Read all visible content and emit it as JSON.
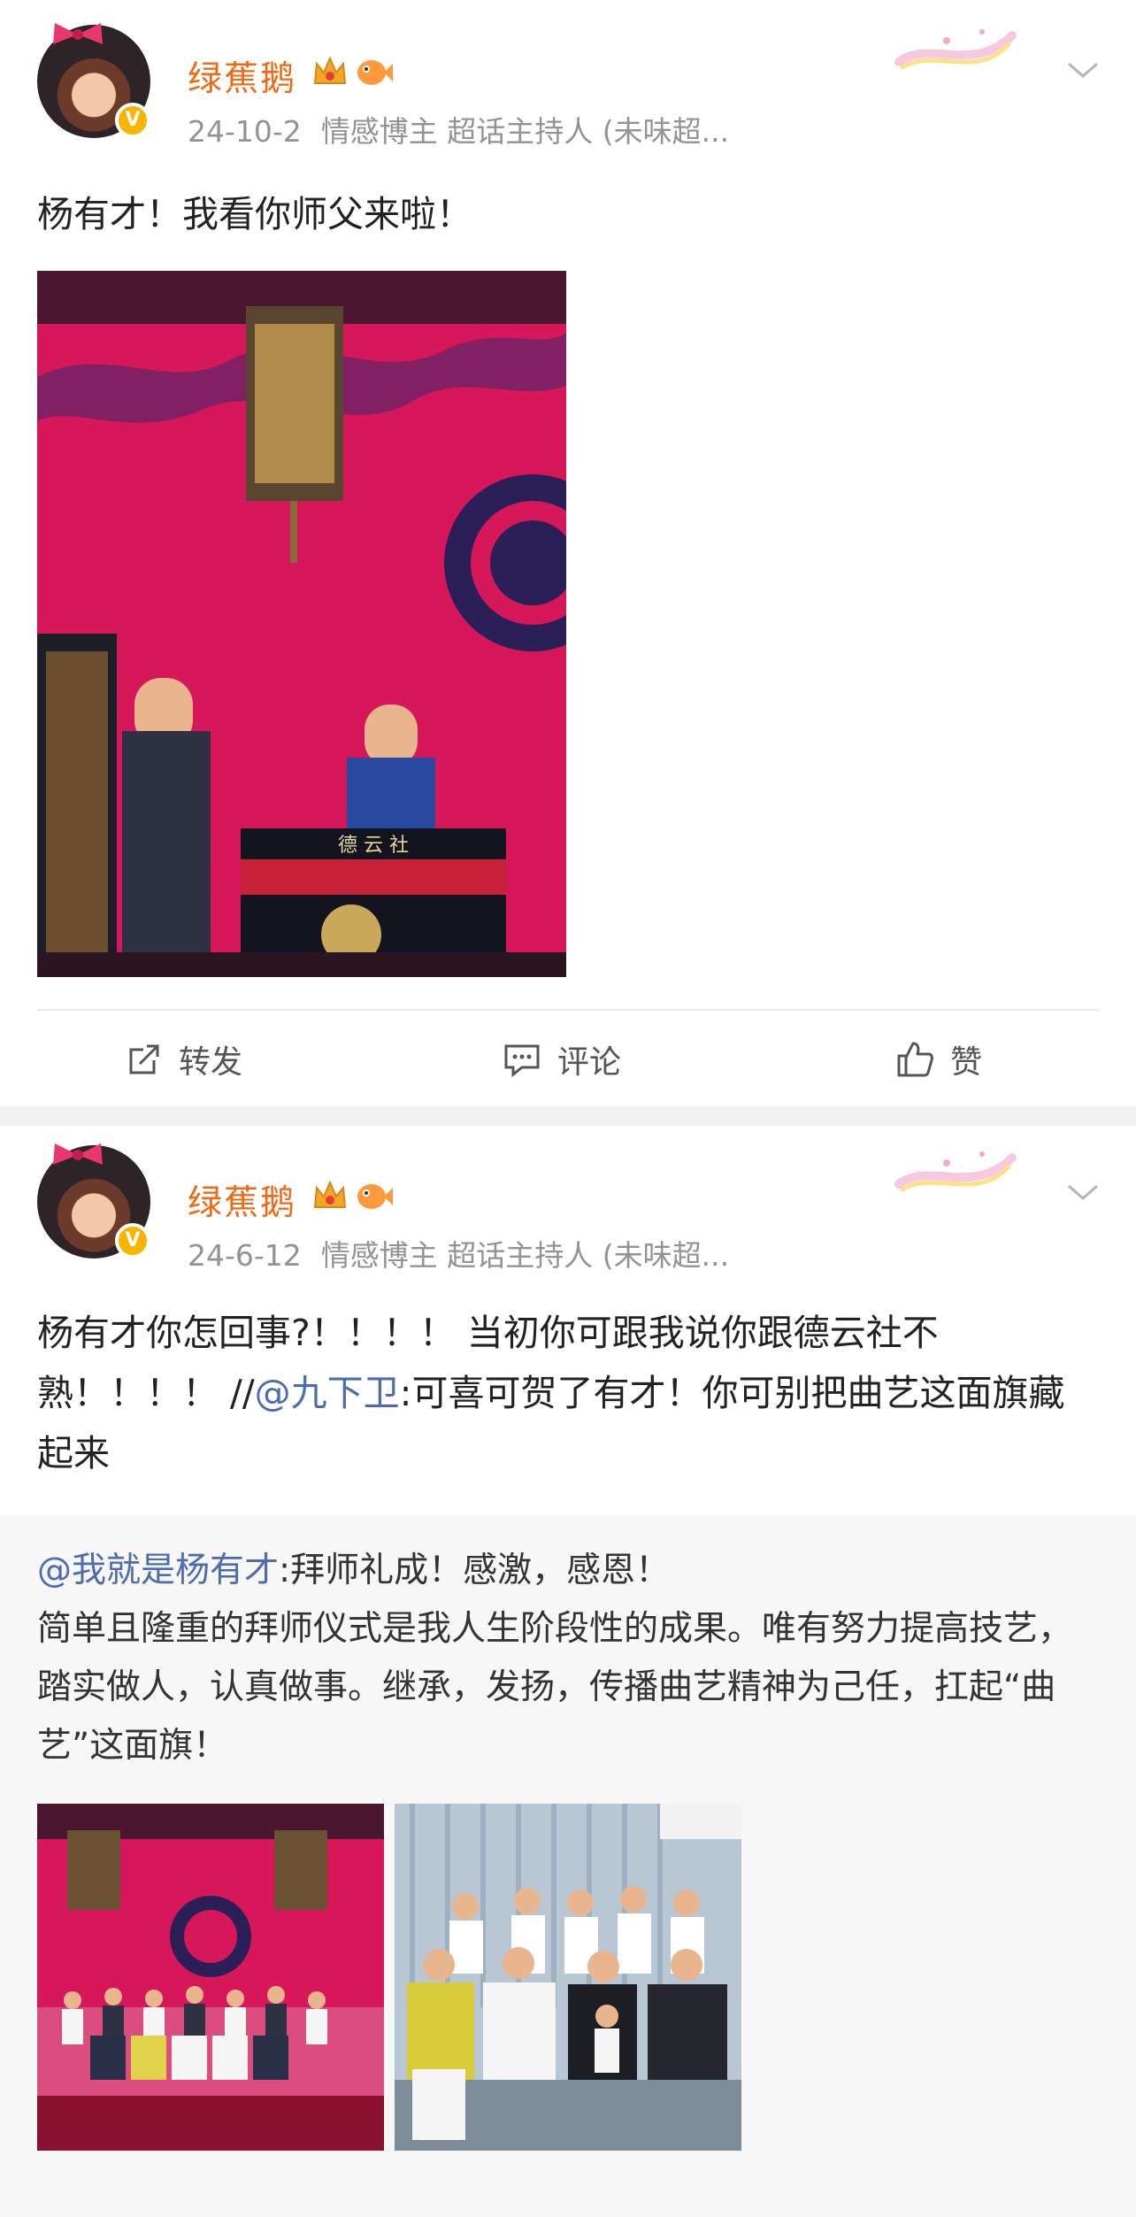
{
  "posts": [
    {
      "author": "绿蕉鹅",
      "date": "24-10-2",
      "tags": "情感博主 超话主持人 (未味超...",
      "text": "杨有才！我看你师父来啦！",
      "badge": "V",
      "stage_sign": "德 云 社",
      "actions": {
        "repost": "转发",
        "comment": "评论",
        "like": "赞"
      }
    },
    {
      "author": "绿蕉鹅",
      "date": "24-6-12",
      "tags": "情感博主 超话主持人 (未味超...",
      "badge": "V",
      "text_parts": {
        "before": "杨有才你怎回事?！！！！ 当初你可跟我说你跟德云社不熟！！！！ //",
        "mention": "@九下卫",
        "after": ":可喜可贺了有才！你可别把曲艺这面旗藏起来"
      },
      "repost": {
        "mention": "@我就是杨有才",
        "headline": ":拜师礼成！感激，感恩！",
        "body": "简单且隆重的拜师仪式是我人生阶段性的成果。唯有努力提高技艺，踏实做人，认真做事。继承，发扬，传播曲艺精神为己任，扛起“曲艺”这面旗！"
      }
    }
  ],
  "colors": {
    "name": "#f06a14",
    "meta": "#939393",
    "mention": "#4d6bb0",
    "stage_red": "#d6175a"
  },
  "icons": [
    "verified-badge-icon",
    "crown-icon",
    "fish-icon",
    "decoration-ribbon-icon",
    "chevron-down-icon",
    "repost-icon",
    "comment-icon",
    "like-icon"
  ]
}
